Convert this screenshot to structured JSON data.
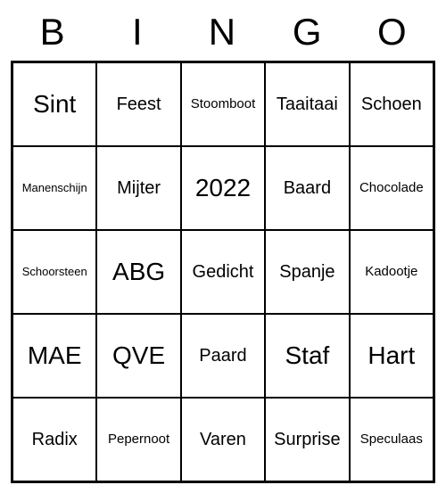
{
  "header": {
    "letters": [
      "B",
      "I",
      "N",
      "G",
      "O"
    ]
  },
  "grid": {
    "rows": [
      [
        {
          "text": "Sint",
          "size": "lg"
        },
        {
          "text": "Feest",
          "size": "md"
        },
        {
          "text": "Stoomboot",
          "size": "sm"
        },
        {
          "text": "Taaitaai",
          "size": "md"
        },
        {
          "text": "Schoen",
          "size": "md"
        }
      ],
      [
        {
          "text": "Manenschijn",
          "size": "xs"
        },
        {
          "text": "Mijter",
          "size": "md"
        },
        {
          "text": "2022",
          "size": "lg"
        },
        {
          "text": "Baard",
          "size": "md"
        },
        {
          "text": "Chocolade",
          "size": "sm"
        }
      ],
      [
        {
          "text": "Schoorsteen",
          "size": "xs"
        },
        {
          "text": "ABG",
          "size": "lg"
        },
        {
          "text": "Gedicht",
          "size": "md"
        },
        {
          "text": "Spanje",
          "size": "md"
        },
        {
          "text": "Kadootje",
          "size": "sm"
        }
      ],
      [
        {
          "text": "MAE",
          "size": "lg"
        },
        {
          "text": "QVE",
          "size": "lg"
        },
        {
          "text": "Paard",
          "size": "md"
        },
        {
          "text": "Staf",
          "size": "lg"
        },
        {
          "text": "Hart",
          "size": "lg"
        }
      ],
      [
        {
          "text": "Radix",
          "size": "md"
        },
        {
          "text": "Pepernoot",
          "size": "sm"
        },
        {
          "text": "Varen",
          "size": "md"
        },
        {
          "text": "Surprise",
          "size": "md"
        },
        {
          "text": "Speculaas",
          "size": "sm"
        }
      ]
    ]
  }
}
